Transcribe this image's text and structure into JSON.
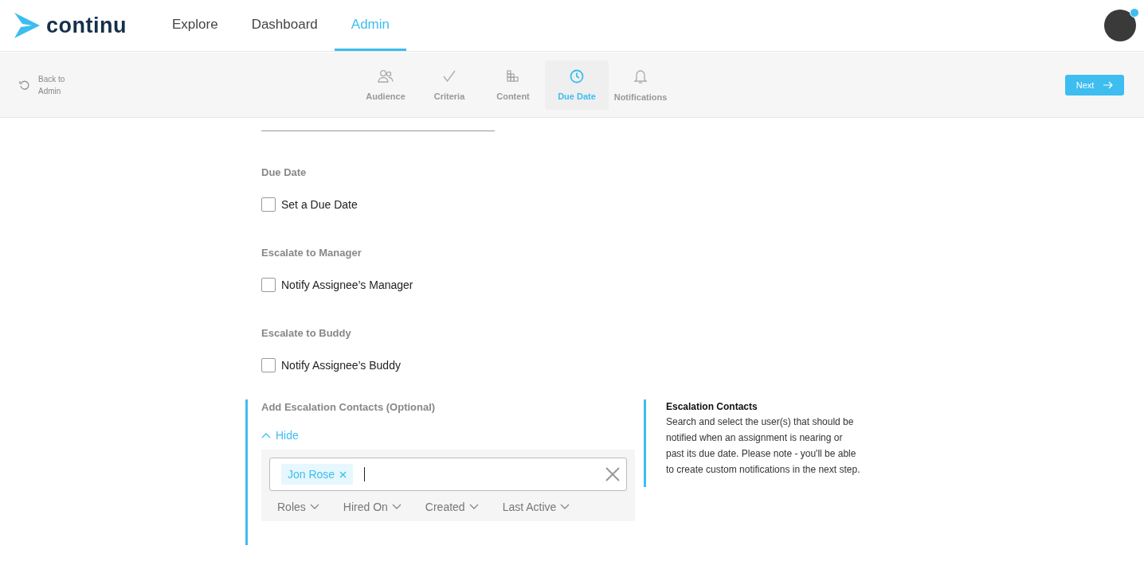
{
  "header": {
    "brand": "continu",
    "nav": [
      {
        "label": "Explore",
        "selected": false
      },
      {
        "label": "Dashboard",
        "selected": false
      },
      {
        "label": "Admin",
        "selected": true
      }
    ],
    "avatar": {
      "notification": true
    }
  },
  "toolbar": {
    "back_link": "Back to Admin",
    "steps": [
      {
        "label": "Audience",
        "kind": "people",
        "selected": false
      },
      {
        "label": "Criteria",
        "kind": "check",
        "selected": false
      },
      {
        "label": "Content",
        "kind": "blocks",
        "selected": false
      },
      {
        "label": "Due Date",
        "kind": "clock",
        "selected": true
      },
      {
        "label": "Notifications",
        "kind": "bell",
        "selected": false
      }
    ],
    "next_button": "Next"
  },
  "form": {
    "sections": [
      {
        "heading": "Due Date",
        "checkbox": {
          "label": "Set a Due Date",
          "checked": false
        }
      },
      {
        "heading": "Escalate to Manager",
        "checkbox": {
          "label": "Notify Assignee’s Manager",
          "checked": false
        }
      },
      {
        "heading": "Escalate to Buddy",
        "checkbox": {
          "label": "Notify Assignee’s Buddy",
          "checked": false
        }
      }
    ],
    "escalation": {
      "heading": "Add Escalation Contacts (Optional)",
      "toggle": "Hide",
      "expanded": true,
      "chips": [
        {
          "label": "Jon Rose"
        }
      ],
      "filters": [
        "Roles",
        "Hired On",
        "Created",
        "Last Active"
      ],
      "help": {
        "title": "Escalation Contacts",
        "text": "Search and select the user(s) that should be notified when an assignment is nearing or past its due date. Please note - you'll be able to create custom notifications in the next step."
      }
    }
  }
}
